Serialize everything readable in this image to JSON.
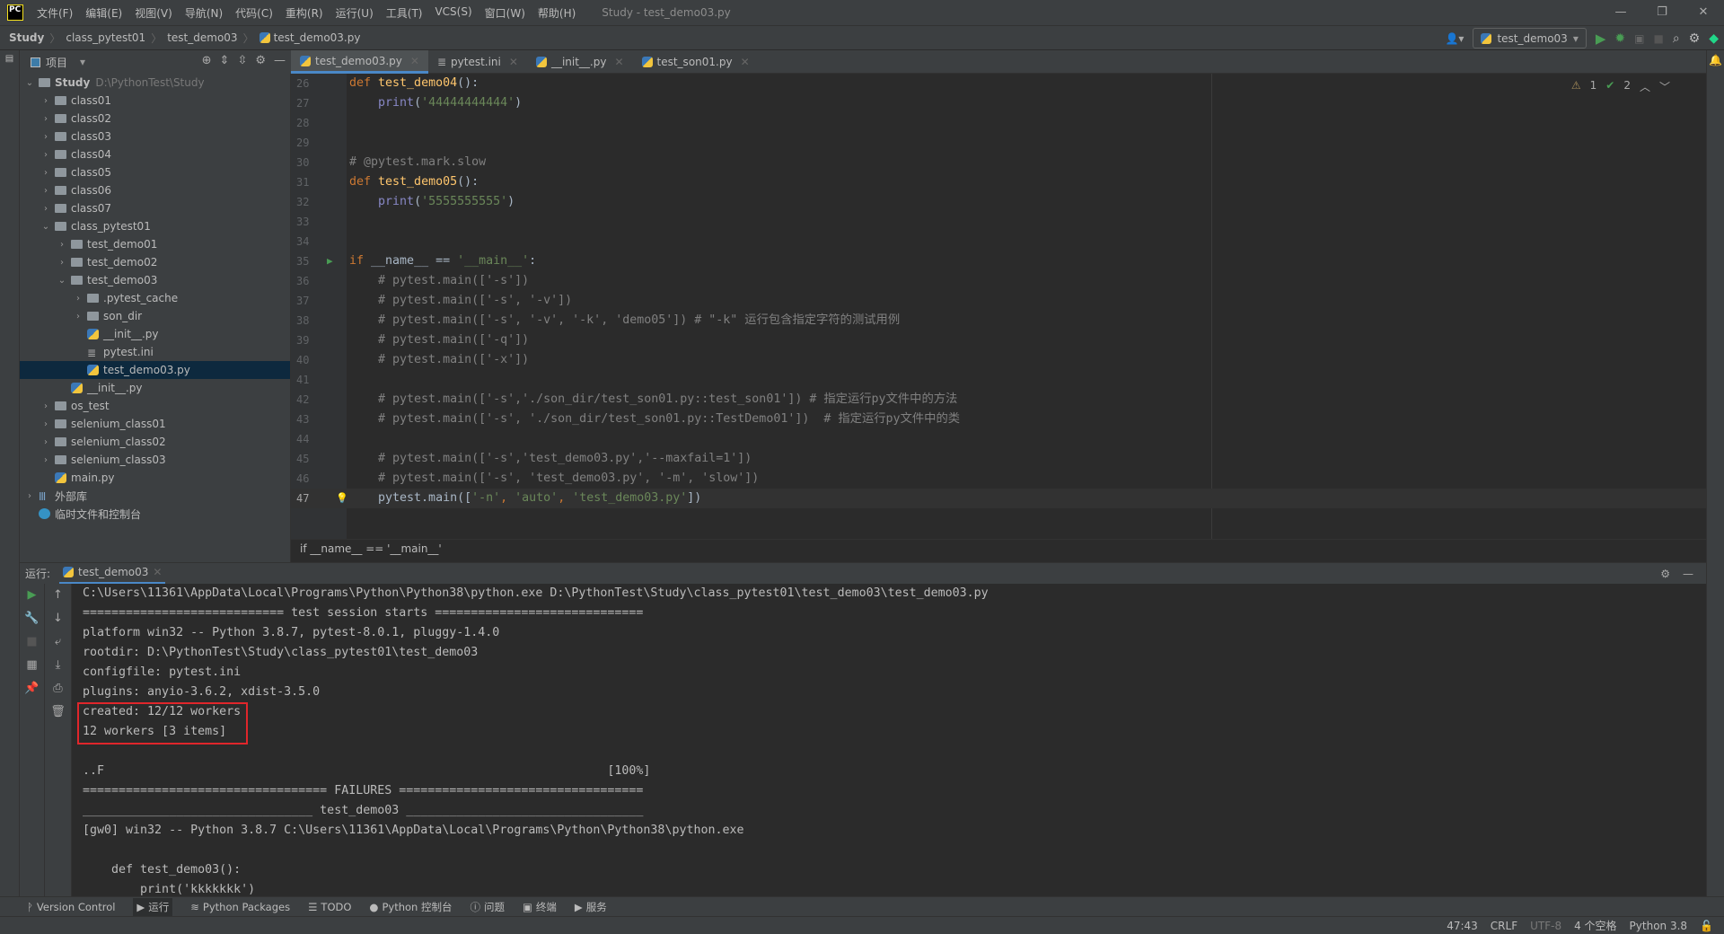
{
  "menubar": {
    "logo": "PC",
    "items": [
      "文件(F)",
      "编辑(E)",
      "视图(V)",
      "导航(N)",
      "代码(C)",
      "重构(R)",
      "运行(U)",
      "工具(T)",
      "VCS(S)",
      "窗口(W)",
      "帮助(H)"
    ],
    "title": "Study - test_demo03.py"
  },
  "navbar": {
    "crumbs": [
      "Study",
      "class_pytest01",
      "test_demo03",
      "test_demo03.py"
    ],
    "run_config": "test_demo03"
  },
  "project": {
    "header": "项目",
    "tree": [
      {
        "label": "Study",
        "hint": "D:\\PythonTest\\Study",
        "level": 0,
        "type": "folder",
        "expanded": true,
        "bold": true
      },
      {
        "label": "class01",
        "level": 1,
        "type": "folder",
        "expanded": false
      },
      {
        "label": "class02",
        "level": 1,
        "type": "folder",
        "expanded": false
      },
      {
        "label": "class03",
        "level": 1,
        "type": "folder",
        "expanded": false
      },
      {
        "label": "class04",
        "level": 1,
        "type": "folder",
        "expanded": false
      },
      {
        "label": "class05",
        "level": 1,
        "type": "folder",
        "expanded": false
      },
      {
        "label": "class06",
        "level": 1,
        "type": "folder",
        "expanded": false
      },
      {
        "label": "class07",
        "level": 1,
        "type": "folder",
        "expanded": false
      },
      {
        "label": "class_pytest01",
        "level": 1,
        "type": "folder",
        "expanded": true
      },
      {
        "label": "test_demo01",
        "level": 2,
        "type": "folder",
        "expanded": false
      },
      {
        "label": "test_demo02",
        "level": 2,
        "type": "folder",
        "expanded": false
      },
      {
        "label": "test_demo03",
        "level": 2,
        "type": "folder",
        "expanded": true
      },
      {
        "label": ".pytest_cache",
        "level": 3,
        "type": "folder",
        "expanded": false
      },
      {
        "label": "son_dir",
        "level": 3,
        "type": "folder",
        "expanded": false
      },
      {
        "label": "__init__.py",
        "level": 3,
        "type": "python"
      },
      {
        "label": "pytest.ini",
        "level": 3,
        "type": "ini"
      },
      {
        "label": "test_demo03.py",
        "level": 3,
        "type": "python",
        "selected": true
      },
      {
        "label": "__init__.py",
        "level": 2,
        "type": "python"
      },
      {
        "label": "os_test",
        "level": 1,
        "type": "folder",
        "expanded": false
      },
      {
        "label": "selenium_class01",
        "level": 1,
        "type": "folder",
        "expanded": false
      },
      {
        "label": "selenium_class02",
        "level": 1,
        "type": "folder",
        "expanded": false
      },
      {
        "label": "selenium_class03",
        "level": 1,
        "type": "folder",
        "expanded": false
      },
      {
        "label": "main.py",
        "level": 1,
        "type": "python"
      },
      {
        "label": "外部库",
        "level": 0,
        "type": "library",
        "expanded": false
      },
      {
        "label": "临时文件和控制台",
        "level": 0,
        "type": "scratch"
      }
    ]
  },
  "tabs": [
    {
      "label": "test_demo03.py",
      "active": true
    },
    {
      "label": "pytest.ini"
    },
    {
      "label": "__init__.py"
    },
    {
      "label": "test_son01.py"
    }
  ],
  "inspections": {
    "warnings": "1",
    "weak_warnings": "2"
  },
  "editor": {
    "current_line": 47,
    "lines": [
      {
        "n": 26,
        "tokens": [
          [
            "keyword",
            "def "
          ],
          [
            "fn",
            "test_demo04"
          ],
          [
            "plain",
            "():"
          ]
        ]
      },
      {
        "n": 27,
        "tokens": [
          [
            "plain",
            "    "
          ],
          [
            "builtin",
            "print"
          ],
          [
            "plain",
            "("
          ],
          [
            "string",
            "'44444444444'"
          ],
          [
            "plain",
            ")"
          ]
        ]
      },
      {
        "n": 28,
        "tokens": []
      },
      {
        "n": 29,
        "tokens": []
      },
      {
        "n": 30,
        "tokens": [
          [
            "comment",
            "# @pytest.mark.slow"
          ]
        ]
      },
      {
        "n": 31,
        "tokens": [
          [
            "keyword",
            "def "
          ],
          [
            "fn",
            "test_demo05"
          ],
          [
            "plain",
            "():"
          ]
        ]
      },
      {
        "n": 32,
        "tokens": [
          [
            "plain",
            "    "
          ],
          [
            "builtin",
            "print"
          ],
          [
            "plain",
            "("
          ],
          [
            "string",
            "'5555555555'"
          ],
          [
            "plain",
            ")"
          ]
        ]
      },
      {
        "n": 33,
        "tokens": []
      },
      {
        "n": 34,
        "tokens": []
      },
      {
        "n": 35,
        "tokens": [
          [
            "keyword",
            "if "
          ],
          [
            "plain",
            "__name__ == "
          ],
          [
            "string",
            "'__main__'"
          ],
          [
            "plain",
            ":"
          ]
        ]
      },
      {
        "n": 36,
        "tokens": [
          [
            "comment",
            "    # pytest.main(['-s'])"
          ]
        ]
      },
      {
        "n": 37,
        "tokens": [
          [
            "comment",
            "    # pytest.main(['-s', '-v'])"
          ]
        ]
      },
      {
        "n": 38,
        "tokens": [
          [
            "comment",
            "    # pytest.main(['-s', '-v', '-k', 'demo05']) # \"-k\" 运行包含指定字符的测试用例"
          ]
        ]
      },
      {
        "n": 39,
        "tokens": [
          [
            "comment",
            "    # pytest.main(['-q'])"
          ]
        ]
      },
      {
        "n": 40,
        "tokens": [
          [
            "comment",
            "    # pytest.main(['-x'])"
          ]
        ]
      },
      {
        "n": 41,
        "tokens": []
      },
      {
        "n": 42,
        "tokens": [
          [
            "comment",
            "    # pytest.main(['-s','./son_dir/test_son01.py::test_son01']) # 指定运行py文件中的方法"
          ]
        ]
      },
      {
        "n": 43,
        "tokens": [
          [
            "comment",
            "    # pytest.main(['-s', './son_dir/test_son01.py::TestDemo01'])  # 指定运行py文件中的类"
          ]
        ]
      },
      {
        "n": 44,
        "tokens": []
      },
      {
        "n": 45,
        "tokens": [
          [
            "comment",
            "    # pytest.main(['-s','test_demo03.py','--maxfail=1'])"
          ]
        ]
      },
      {
        "n": 46,
        "tokens": [
          [
            "comment",
            "    # pytest.main(['-s', 'test_demo03.py', '-m', 'slow'])"
          ]
        ]
      },
      {
        "n": 47,
        "tokens": [
          [
            "plain",
            "    pytest.main(["
          ],
          [
            "string",
            "'-n'"
          ],
          [
            "keyword",
            ", "
          ],
          [
            "string",
            "'auto'"
          ],
          [
            "keyword",
            ", "
          ],
          [
            "string",
            "'test_demo03.py'"
          ],
          [
            "plain",
            "])"
          ]
        ]
      }
    ],
    "breadcrumb": "if __name__ == '__main__'"
  },
  "run": {
    "label": "运行:",
    "tab": "test_demo03",
    "console": [
      "C:\\Users\\11361\\AppData\\Local\\Programs\\Python\\Python38\\python.exe D:\\PythonTest\\Study\\class_pytest01\\test_demo03\\test_demo03.py",
      "============================ test session starts =============================",
      "platform win32 -- Python 3.8.7, pytest-8.0.1, pluggy-1.4.0",
      "rootdir: D:\\PythonTest\\Study\\class_pytest01\\test_demo03",
      "configfile: pytest.ini",
      "plugins: anyio-3.6.2, xdist-3.5.0",
      "created: 12/12 workers",
      "12 workers [3 items]",
      "",
      "..F                                                                      [100%]",
      "================================== FAILURES ==================================",
      "________________________________ test_demo03 _________________________________",
      "[gw0] win32 -- Python 3.8.7 C:\\Users\\11361\\AppData\\Local\\Programs\\Python\\Python38\\python.exe",
      "",
      "    def test_demo03():",
      "        print('kkkkkkk')"
    ]
  },
  "bottom_tools": [
    "Version Control",
    "运行",
    "Python Packages",
    "TODO",
    "Python 控制台",
    "问题",
    "终端",
    "服务"
  ],
  "status": {
    "position": "47:43",
    "line_sep": "CRLF",
    "encoding": "UTF-8",
    "indent": "4 个空格",
    "interpreter": "Python 3.8"
  },
  "colors": {
    "accent": "#4a88c7",
    "highlight_box": "#e0262b",
    "run_green": "#499c54"
  }
}
